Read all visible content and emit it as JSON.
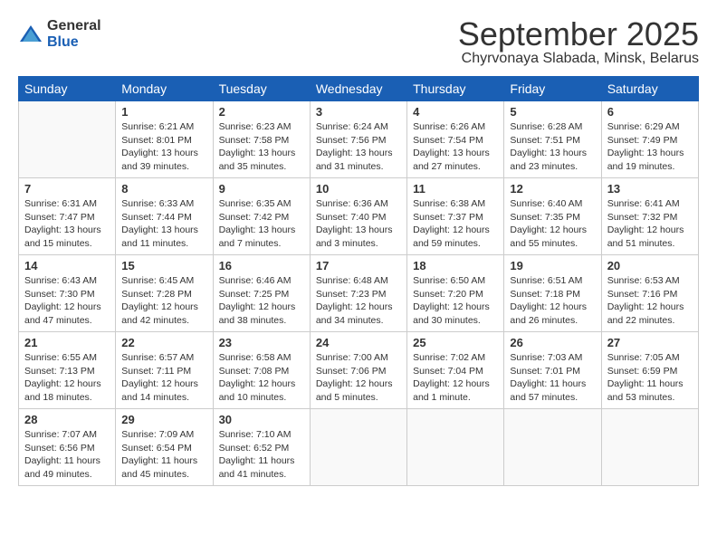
{
  "logo": {
    "general": "General",
    "blue": "Blue"
  },
  "title": "September 2025",
  "subtitle": "Chyrvonaya Slabada, Minsk, Belarus",
  "days_of_week": [
    "Sunday",
    "Monday",
    "Tuesday",
    "Wednesday",
    "Thursday",
    "Friday",
    "Saturday"
  ],
  "weeks": [
    [
      {
        "day": "",
        "info": ""
      },
      {
        "day": "1",
        "info": "Sunrise: 6:21 AM\nSunset: 8:01 PM\nDaylight: 13 hours\nand 39 minutes."
      },
      {
        "day": "2",
        "info": "Sunrise: 6:23 AM\nSunset: 7:58 PM\nDaylight: 13 hours\nand 35 minutes."
      },
      {
        "day": "3",
        "info": "Sunrise: 6:24 AM\nSunset: 7:56 PM\nDaylight: 13 hours\nand 31 minutes."
      },
      {
        "day": "4",
        "info": "Sunrise: 6:26 AM\nSunset: 7:54 PM\nDaylight: 13 hours\nand 27 minutes."
      },
      {
        "day": "5",
        "info": "Sunrise: 6:28 AM\nSunset: 7:51 PM\nDaylight: 13 hours\nand 23 minutes."
      },
      {
        "day": "6",
        "info": "Sunrise: 6:29 AM\nSunset: 7:49 PM\nDaylight: 13 hours\nand 19 minutes."
      }
    ],
    [
      {
        "day": "7",
        "info": "Sunrise: 6:31 AM\nSunset: 7:47 PM\nDaylight: 13 hours\nand 15 minutes."
      },
      {
        "day": "8",
        "info": "Sunrise: 6:33 AM\nSunset: 7:44 PM\nDaylight: 13 hours\nand 11 minutes."
      },
      {
        "day": "9",
        "info": "Sunrise: 6:35 AM\nSunset: 7:42 PM\nDaylight: 13 hours\nand 7 minutes."
      },
      {
        "day": "10",
        "info": "Sunrise: 6:36 AM\nSunset: 7:40 PM\nDaylight: 13 hours\nand 3 minutes."
      },
      {
        "day": "11",
        "info": "Sunrise: 6:38 AM\nSunset: 7:37 PM\nDaylight: 12 hours\nand 59 minutes."
      },
      {
        "day": "12",
        "info": "Sunrise: 6:40 AM\nSunset: 7:35 PM\nDaylight: 12 hours\nand 55 minutes."
      },
      {
        "day": "13",
        "info": "Sunrise: 6:41 AM\nSunset: 7:32 PM\nDaylight: 12 hours\nand 51 minutes."
      }
    ],
    [
      {
        "day": "14",
        "info": "Sunrise: 6:43 AM\nSunset: 7:30 PM\nDaylight: 12 hours\nand 47 minutes."
      },
      {
        "day": "15",
        "info": "Sunrise: 6:45 AM\nSunset: 7:28 PM\nDaylight: 12 hours\nand 42 minutes."
      },
      {
        "day": "16",
        "info": "Sunrise: 6:46 AM\nSunset: 7:25 PM\nDaylight: 12 hours\nand 38 minutes."
      },
      {
        "day": "17",
        "info": "Sunrise: 6:48 AM\nSunset: 7:23 PM\nDaylight: 12 hours\nand 34 minutes."
      },
      {
        "day": "18",
        "info": "Sunrise: 6:50 AM\nSunset: 7:20 PM\nDaylight: 12 hours\nand 30 minutes."
      },
      {
        "day": "19",
        "info": "Sunrise: 6:51 AM\nSunset: 7:18 PM\nDaylight: 12 hours\nand 26 minutes."
      },
      {
        "day": "20",
        "info": "Sunrise: 6:53 AM\nSunset: 7:16 PM\nDaylight: 12 hours\nand 22 minutes."
      }
    ],
    [
      {
        "day": "21",
        "info": "Sunrise: 6:55 AM\nSunset: 7:13 PM\nDaylight: 12 hours\nand 18 minutes."
      },
      {
        "day": "22",
        "info": "Sunrise: 6:57 AM\nSunset: 7:11 PM\nDaylight: 12 hours\nand 14 minutes."
      },
      {
        "day": "23",
        "info": "Sunrise: 6:58 AM\nSunset: 7:08 PM\nDaylight: 12 hours\nand 10 minutes."
      },
      {
        "day": "24",
        "info": "Sunrise: 7:00 AM\nSunset: 7:06 PM\nDaylight: 12 hours\nand 5 minutes."
      },
      {
        "day": "25",
        "info": "Sunrise: 7:02 AM\nSunset: 7:04 PM\nDaylight: 12 hours\nand 1 minute."
      },
      {
        "day": "26",
        "info": "Sunrise: 7:03 AM\nSunset: 7:01 PM\nDaylight: 11 hours\nand 57 minutes."
      },
      {
        "day": "27",
        "info": "Sunrise: 7:05 AM\nSunset: 6:59 PM\nDaylight: 11 hours\nand 53 minutes."
      }
    ],
    [
      {
        "day": "28",
        "info": "Sunrise: 7:07 AM\nSunset: 6:56 PM\nDaylight: 11 hours\nand 49 minutes."
      },
      {
        "day": "29",
        "info": "Sunrise: 7:09 AM\nSunset: 6:54 PM\nDaylight: 11 hours\nand 45 minutes."
      },
      {
        "day": "30",
        "info": "Sunrise: 7:10 AM\nSunset: 6:52 PM\nDaylight: 11 hours\nand 41 minutes."
      },
      {
        "day": "",
        "info": ""
      },
      {
        "day": "",
        "info": ""
      },
      {
        "day": "",
        "info": ""
      },
      {
        "day": "",
        "info": ""
      }
    ]
  ]
}
